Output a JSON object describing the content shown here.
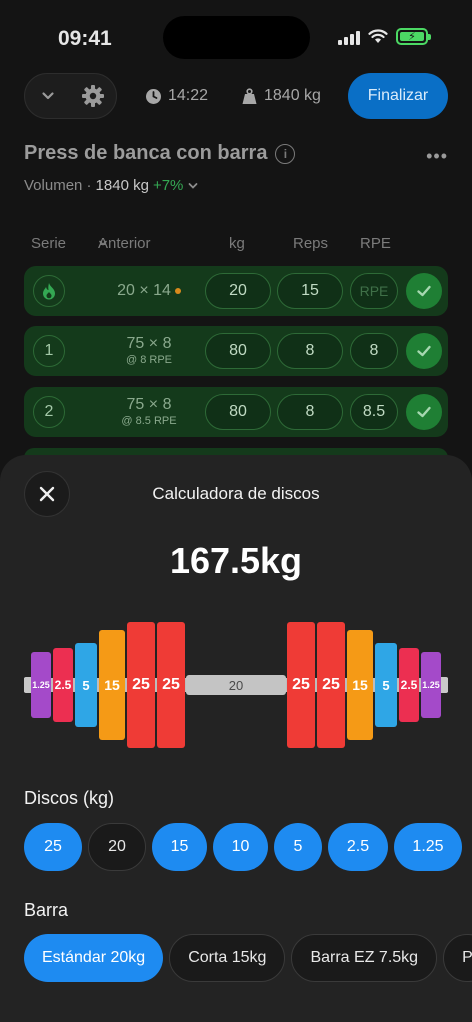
{
  "status": {
    "time": "09:41"
  },
  "toolbar": {
    "timer": "14:22",
    "volume": "1840 kg",
    "finish_label": "Finalizar"
  },
  "exercise": {
    "title": "Press de banca con barra",
    "info_glyph": "i",
    "volume_label": "Volumen ·",
    "volume_value": "1840 kg",
    "volume_delta": "+7%"
  },
  "set_table": {
    "headers": {
      "set": "Serie",
      "previous": "Anterior",
      "kg": "kg",
      "reps": "Reps",
      "rpe": "RPE"
    },
    "rows": [
      {
        "badge": "warmup",
        "previous": "20 × 14",
        "previous_sub": "",
        "kg": "20",
        "reps": "15",
        "rpe": "RPE",
        "done": true
      },
      {
        "badge": "1",
        "previous": "75 × 8",
        "previous_sub": "@ 8 RPE",
        "kg": "80",
        "reps": "8",
        "rpe": "8",
        "done": true
      },
      {
        "badge": "2",
        "previous": "75 × 8",
        "previous_sub": "@ 8.5 RPE",
        "kg": "80",
        "reps": "8",
        "rpe": "8.5",
        "done": true
      }
    ]
  },
  "plate_calculator": {
    "title": "Calculadora de discos",
    "total": "167.5kg",
    "bar_label": "20",
    "plates_per_side": [
      "25",
      "25",
      "15",
      "5",
      "2.5",
      "1.25"
    ],
    "plate_colors": {
      "25": "#ef3b36",
      "15": "#f59a16",
      "5": "#2fa6e6",
      "2.5": "#ec2f51",
      "1.25": "#a44ac9"
    },
    "discs_label": "Discos (kg)",
    "discs": [
      {
        "label": "25",
        "selected": true
      },
      {
        "label": "20",
        "selected": false
      },
      {
        "label": "15",
        "selected": true
      },
      {
        "label": "10",
        "selected": true
      },
      {
        "label": "5",
        "selected": true
      },
      {
        "label": "2.5",
        "selected": true
      },
      {
        "label": "1.25",
        "selected": true
      }
    ],
    "bar_section_label": "Barra",
    "bars": [
      {
        "label": "Estándar 20kg",
        "selected": true
      },
      {
        "label": "Corta 15kg",
        "selected": false
      },
      {
        "label": "Barra EZ 7.5kg",
        "selected": false
      },
      {
        "label": "P",
        "selected": false
      }
    ]
  }
}
